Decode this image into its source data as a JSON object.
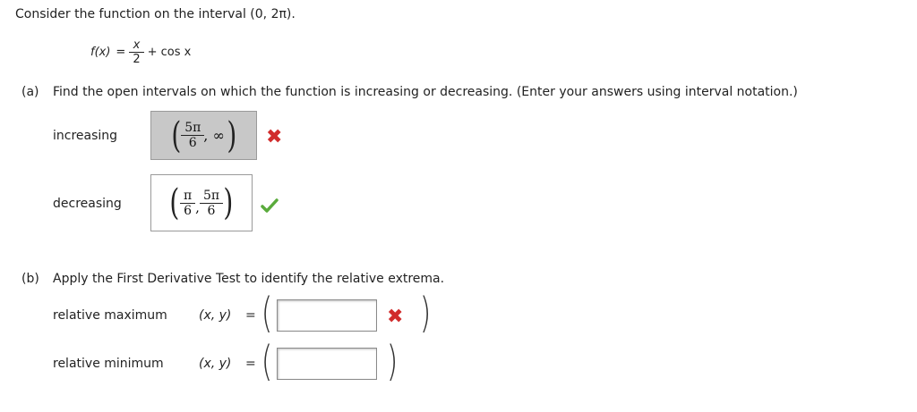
{
  "question": {
    "intro": "Consider the function on the interval (0, 2π).",
    "function_lhs": "f(x)",
    "equals": "=",
    "frac_num": "x",
    "frac_den": "2",
    "function_rhs": "+ cos x"
  },
  "part_a": {
    "label": "(a)",
    "prompt": "Find the open intervals on which the function is increasing or decreasing. (Enter your answers using interval notation.)",
    "increasing": {
      "label": "increasing",
      "answer_num": "5π",
      "answer_den": "6",
      "answer_tail": ", ∞",
      "status": "incorrect"
    },
    "decreasing": {
      "label": "decreasing",
      "a_num": "π",
      "a_den": "6",
      "sep": ",",
      "b_num": "5π",
      "b_den": "6",
      "status": "correct"
    }
  },
  "part_b": {
    "label": "(b)",
    "prompt": "Apply the First Derivative Test to identify the relative extrema.",
    "maximum": {
      "label": "relative maximum",
      "coords": "(x, y)",
      "equals": "=",
      "value": "",
      "status": "incorrect"
    },
    "minimum": {
      "label": "relative minimum",
      "coords": "(x, y)",
      "equals": "=",
      "value": ""
    }
  },
  "icons": {
    "incorrect_color": "#d12b2b",
    "correct_color": "#5aab3c"
  }
}
